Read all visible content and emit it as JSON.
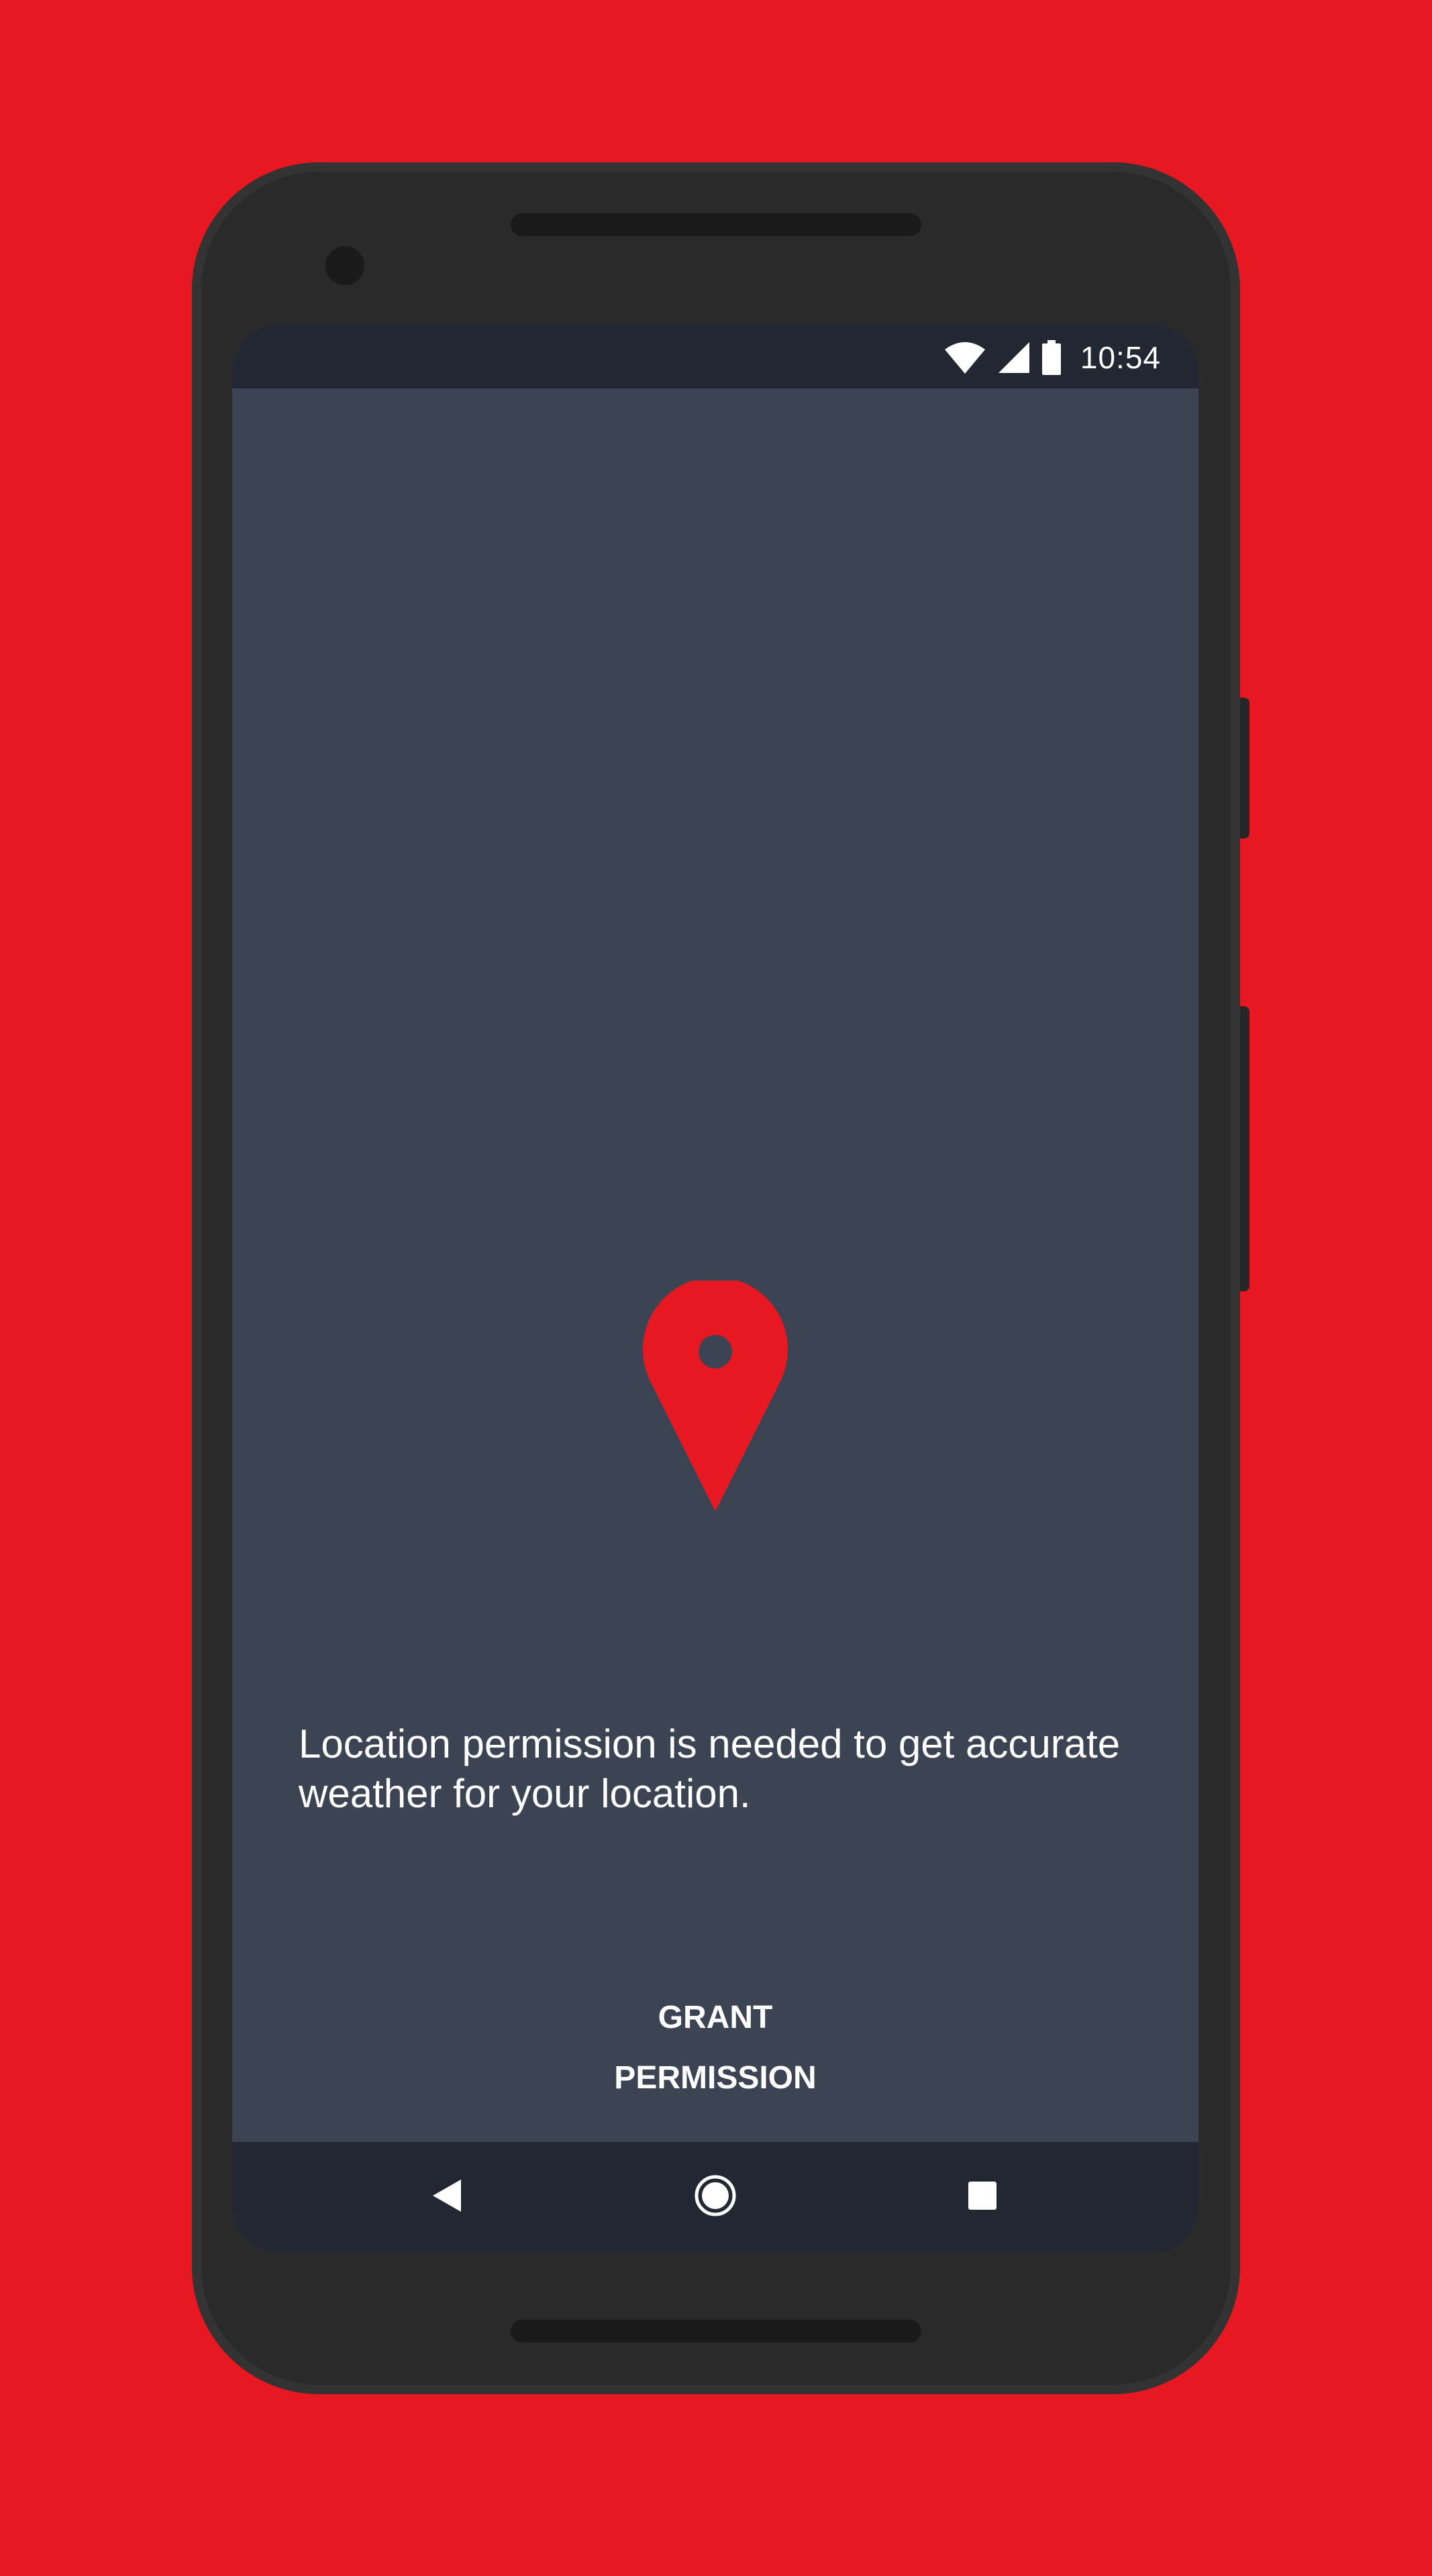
{
  "colors": {
    "background": "#E71821",
    "screen": "#3C4353",
    "bars": "#232731",
    "accent": "#E71821",
    "text": "#FFFFFF"
  },
  "status_bar": {
    "time": "10:54",
    "icons": [
      "wifi-icon",
      "cell-signal-icon",
      "battery-icon"
    ]
  },
  "main": {
    "icon": "location-pin-icon",
    "message": "Location permission is needed to get accurate weather for your location.",
    "grant_button": "GRANT PERMISSION"
  },
  "nav_bar": {
    "buttons": [
      "back-icon",
      "home-icon",
      "recents-icon"
    ]
  }
}
